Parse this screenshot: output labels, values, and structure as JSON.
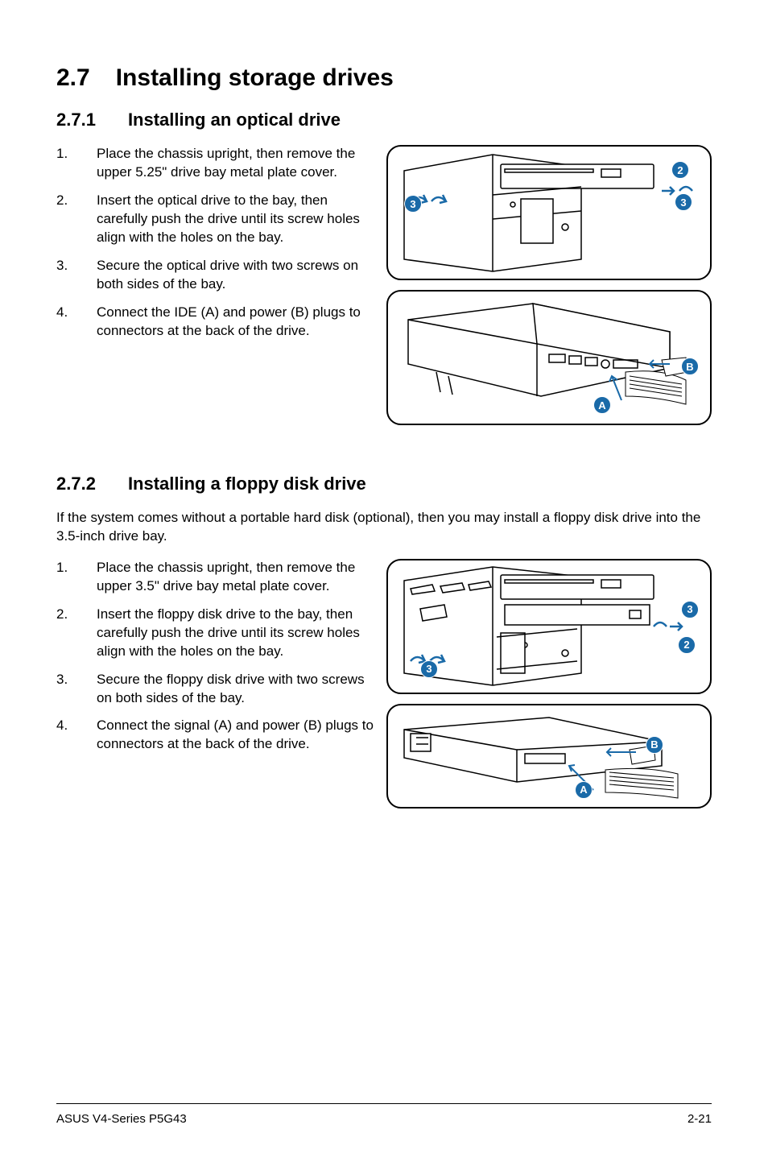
{
  "main_heading": {
    "number": "2.7",
    "title": "Installing storage drives"
  },
  "section1": {
    "number": "2.7.1",
    "title": "Installing an optical drive",
    "steps": [
      {
        "num": "1.",
        "text": "Place the chassis upright, then remove the upper 5.25\" drive bay metal plate cover."
      },
      {
        "num": "2.",
        "text": "Insert the optical drive to the bay, then carefully push the drive until its screw holes align with the holes on the bay."
      },
      {
        "num": "3.",
        "text": "Secure the optical drive with two screws on both sides of the bay."
      },
      {
        "num": "4.",
        "text": "Connect the IDE (A) and power (B) plugs to connectors at the back of the drive."
      }
    ],
    "fig1_callouts": {
      "c2": "2",
      "c3a": "3",
      "c3b": "3"
    },
    "fig2_callouts": {
      "a": "A",
      "b": "B"
    }
  },
  "section2": {
    "number": "2.7.2",
    "title": "Installing a floppy disk drive",
    "intro": "If the system comes without a portable hard disk (optional), then you may install a floppy disk drive into the 3.5-inch drive bay.",
    "steps": [
      {
        "num": "1.",
        "text": "Place the chassis upright, then remove the upper 3.5\" drive bay metal plate cover."
      },
      {
        "num": "2.",
        "text": "Insert the floppy disk drive to the bay, then carefully push the drive until its screw holes align with the holes on the bay."
      },
      {
        "num": "3.",
        "text": "Secure the floppy disk drive with two screws on both sides of the bay."
      },
      {
        "num": "4.",
        "text": "Connect the signal (A) and power (B) plugs to connectors at the back of the drive."
      }
    ],
    "fig1_callouts": {
      "c2": "2",
      "c3a": "3",
      "c3b": "3"
    },
    "fig2_callouts": {
      "a": "A",
      "b": "B"
    }
  },
  "footer": {
    "left": "ASUS V4-Series P5G43",
    "right": "2-21"
  }
}
